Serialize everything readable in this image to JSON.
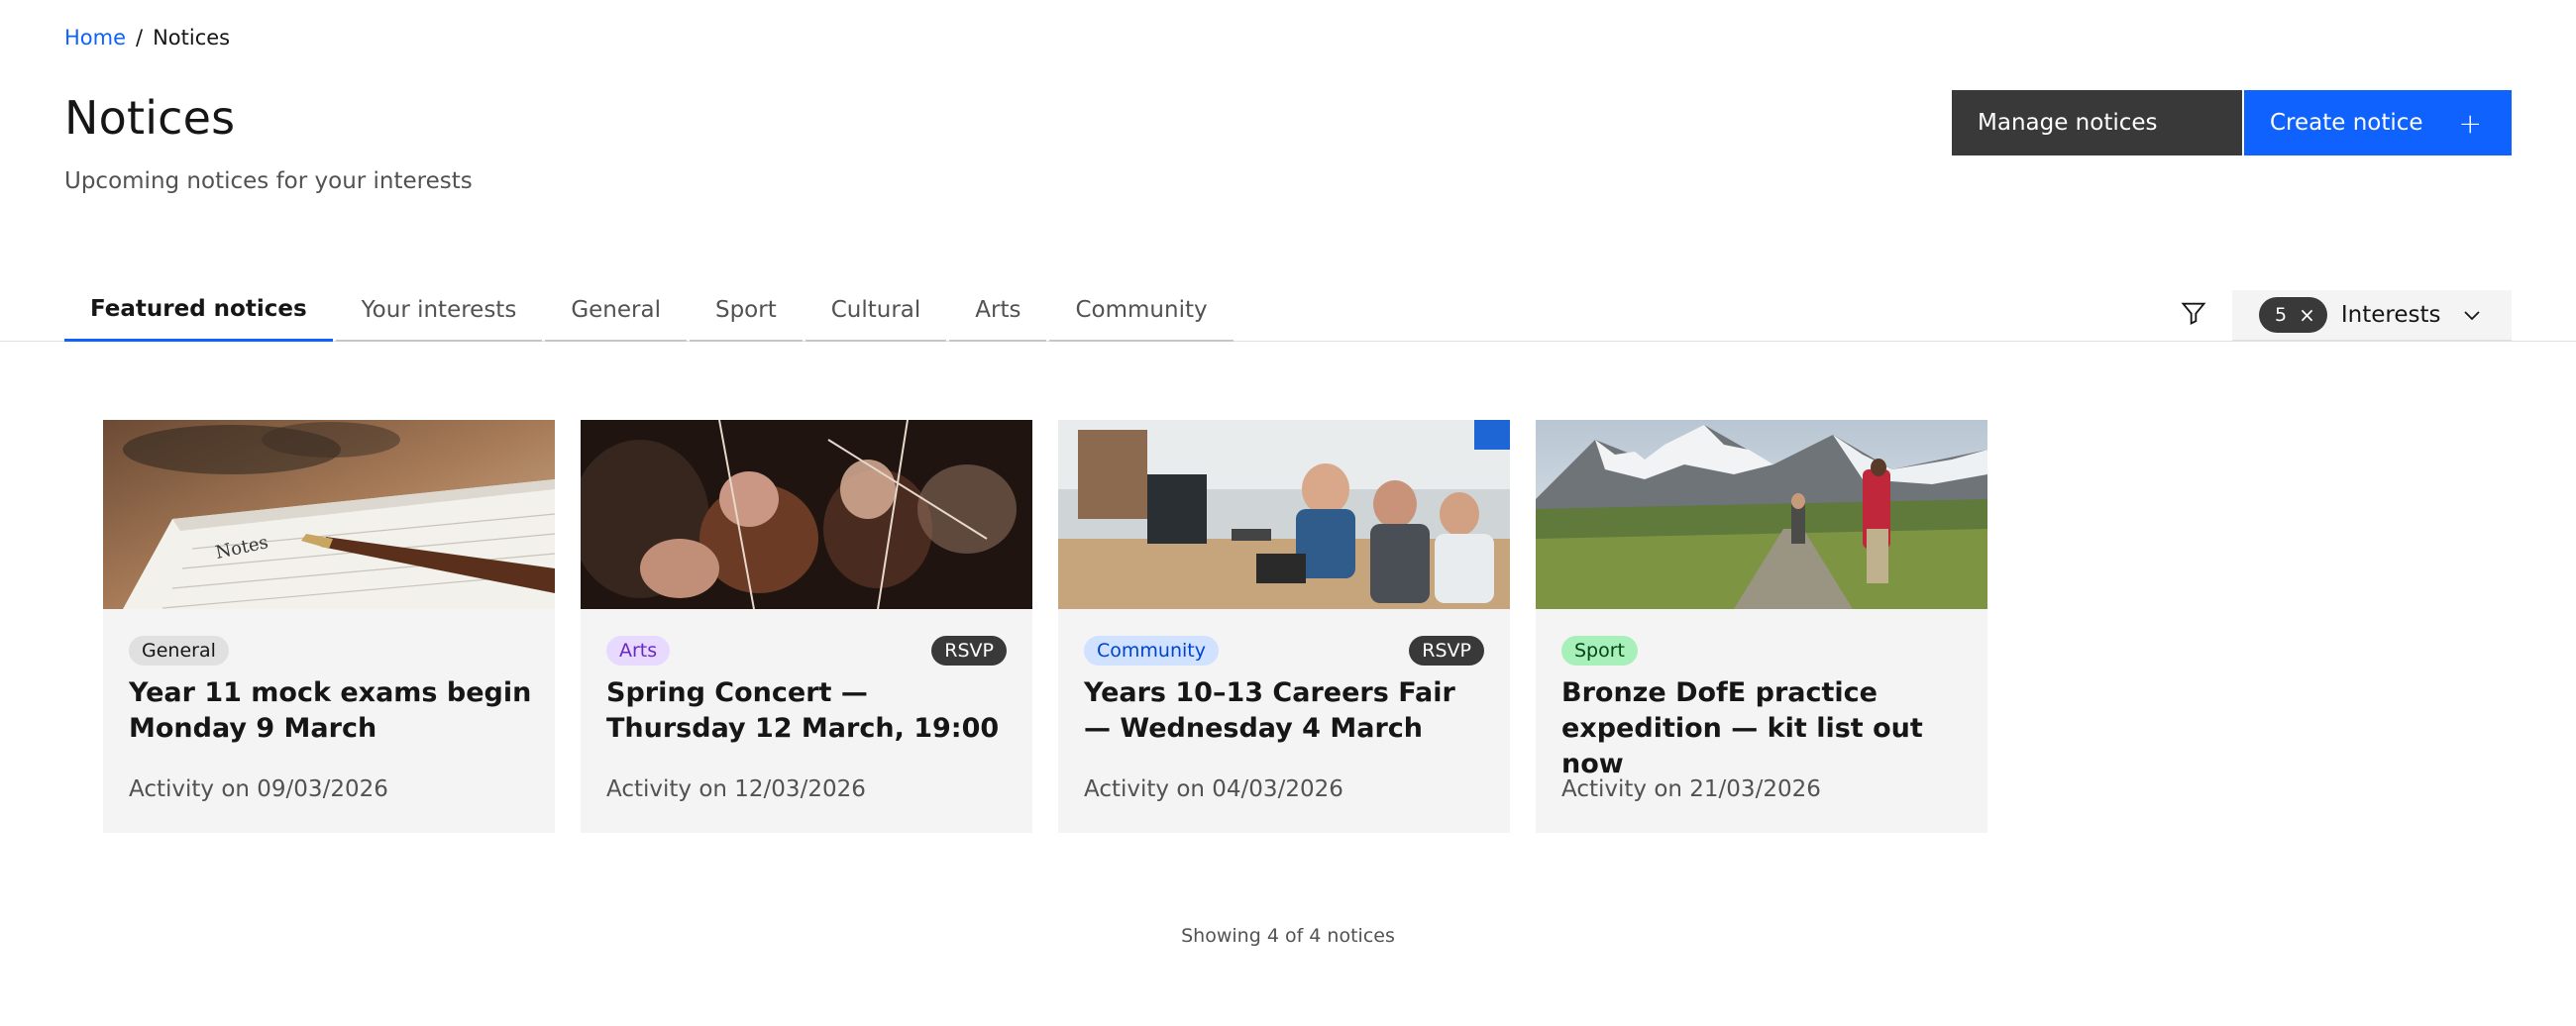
{
  "breadcrumb": {
    "home": "Home",
    "separator": "/",
    "current": "Notices"
  },
  "header": {
    "title": "Notices",
    "subtitle": "Upcoming notices for your interests",
    "manage_label": "Manage notices",
    "create_label": "Create notice",
    "create_icon": "+"
  },
  "tabs": [
    {
      "label": "Featured notices",
      "active": true
    },
    {
      "label": "Your interests",
      "active": false
    },
    {
      "label": "General",
      "active": false
    },
    {
      "label": "Sport",
      "active": false
    },
    {
      "label": "Cultural",
      "active": false
    },
    {
      "label": "Arts",
      "active": false
    },
    {
      "label": "Community",
      "active": false
    }
  ],
  "filter": {
    "icon": "filter-icon",
    "count": "5",
    "clear_icon": "×",
    "label": "Interests",
    "chevron_icon": "chevron-down-icon"
  },
  "cards": [
    {
      "category": "General",
      "rsvp": "",
      "title": "Year 11 mock exams begin Monday 9 March",
      "date": "Activity on 09/03/2026",
      "image": "notebook-pen-photo"
    },
    {
      "category": "Arts",
      "rsvp": "RSVP",
      "title": "Spring Concert — Thursday 12 March, 19:00",
      "date": "Activity on 12/03/2026",
      "image": "orchestra-violins-photo"
    },
    {
      "category": "Community",
      "rsvp": "RSVP",
      "title": "Years 10–13 Careers Fair — Wednesday 4 March",
      "date": "Activity on 04/03/2026",
      "image": "office-meeting-photo"
    },
    {
      "category": "Sport",
      "rsvp": "",
      "title": "Bronze DofE practice expedition — kit list out now",
      "date": "Activity on 21/03/2026",
      "image": "mountain-hikers-photo"
    }
  ],
  "footer": {
    "summary": "Showing 4 of 4 notices"
  },
  "colors": {
    "primary": "#0f62fe",
    "dark": "#393939",
    "card_bg": "#f4f4f4"
  }
}
